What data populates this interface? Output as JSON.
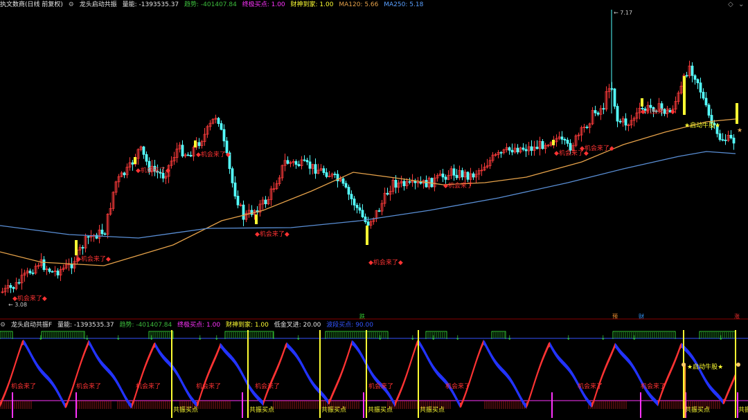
{
  "header": {
    "title": "执文数商(日线 前复权)",
    "indicator_name": "龙头启动共振",
    "items": [
      {
        "label": "量能: -1393535.37",
        "color": "#e6e6e6"
      },
      {
        "label": "趋势: -401407.84",
        "color": "#3cbc3c"
      },
      {
        "label": "终极买点: 1.00",
        "color": "#ff33ff"
      },
      {
        "label": "财神到家: 1.00",
        "color": "#ffff33"
      },
      {
        "label": "MA120: 5.66",
        "color": "#e6a24a"
      },
      {
        "label": "MA250: 5.18",
        "color": "#5aa0ff"
      }
    ]
  },
  "sub_header": {
    "title": "龙头启动共振F",
    "items": [
      {
        "label": "量能: -1393535.37",
        "color": "#e6e6e6"
      },
      {
        "label": "趋势: -401407.84",
        "color": "#3cbc3c"
      },
      {
        "label": "终极买点: 1.00",
        "color": "#ff33ff"
      },
      {
        "label": "财神到家: 1.00",
        "color": "#ffff33"
      },
      {
        "label": "低金叉进: 20.00",
        "color": "#e6e6e6"
      },
      {
        "label": "波段买点: 90.00",
        "color": "#3355ff"
      }
    ]
  },
  "main_chart": {
    "high_label": "7.17",
    "low_label": "3.08",
    "signal_text": "机会来了",
    "start_text": "启动牛股",
    "event_labels": [
      {
        "text": "跌",
        "color": "#33cc33"
      },
      {
        "text": "预",
        "color": "#ff9933"
      },
      {
        "text": "财",
        "color": "#3399ff"
      },
      {
        "text": "涨",
        "color": "#ff3333"
      }
    ]
  },
  "sub_chart": {
    "signal_text": "机会来了",
    "buy_text": "共振买点",
    "start_text": "启动牛股"
  },
  "colors": {
    "up": "#ff3b3b",
    "down": "#54ffff",
    "ma120": "#e6a24a",
    "ma250": "#5a8fd6",
    "signal": "#ff3333",
    "yellow": "#ffff33",
    "magenta": "#ff33ff"
  }
}
